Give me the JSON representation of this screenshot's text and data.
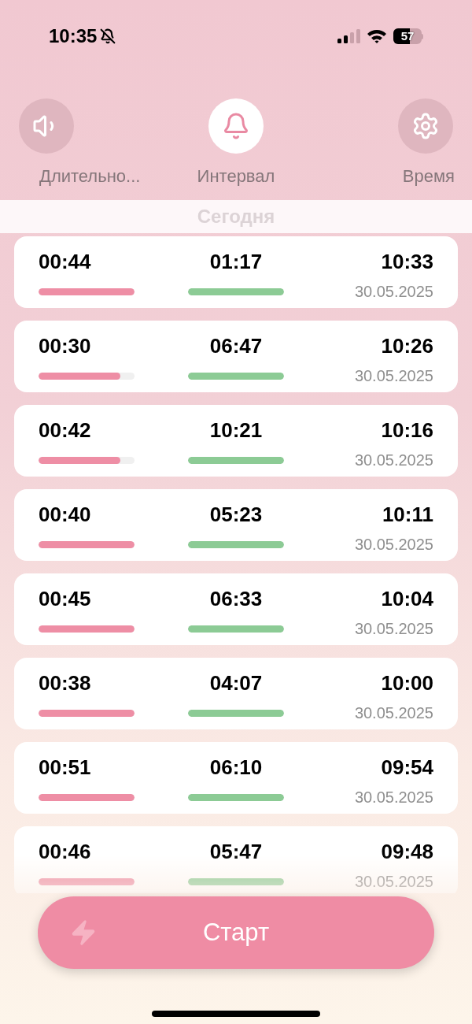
{
  "status_bar": {
    "time": "10:35",
    "battery": "57"
  },
  "tabs": [
    {
      "label": "Длительно...",
      "selected": false
    },
    {
      "label": "Интервал",
      "selected": true
    },
    {
      "label": "Время",
      "selected": false
    }
  ],
  "section_title": "Сегодня",
  "rows": [
    {
      "duration": {
        "text": "00:44",
        "level": 1
      },
      "interval": {
        "text": "01:17",
        "level": 1
      },
      "time": "10:33",
      "date": "30.05.2025"
    },
    {
      "duration": {
        "text": "00:30",
        "level": 0.85
      },
      "interval": {
        "text": "06:47",
        "level": 1
      },
      "time": "10:26",
      "date": "30.05.2025"
    },
    {
      "duration": {
        "text": "00:42",
        "level": 0.85
      },
      "interval": {
        "text": "10:21",
        "level": 1
      },
      "time": "10:16",
      "date": "30.05.2025"
    },
    {
      "duration": {
        "text": "00:40",
        "level": 1
      },
      "interval": {
        "text": "05:23",
        "level": 1
      },
      "time": "10:11",
      "date": "30.05.2025"
    },
    {
      "duration": {
        "text": "00:45",
        "level": 1
      },
      "interval": {
        "text": "06:33",
        "level": 1
      },
      "time": "10:04",
      "date": "30.05.2025"
    },
    {
      "duration": {
        "text": "00:38",
        "level": 1
      },
      "interval": {
        "text": "04:07",
        "level": 1
      },
      "time": "10:00",
      "date": "30.05.2025"
    },
    {
      "duration": {
        "text": "00:51",
        "level": 1
      },
      "interval": {
        "text": "06:10",
        "level": 1
      },
      "time": "09:54",
      "date": "30.05.2025"
    },
    {
      "duration": {
        "text": "00:46",
        "level": 1
      },
      "interval": {
        "text": "05:47",
        "level": 1
      },
      "time": "09:48",
      "date": "30.05.2025"
    }
  ],
  "start_button": {
    "label": "Старт"
  }
}
